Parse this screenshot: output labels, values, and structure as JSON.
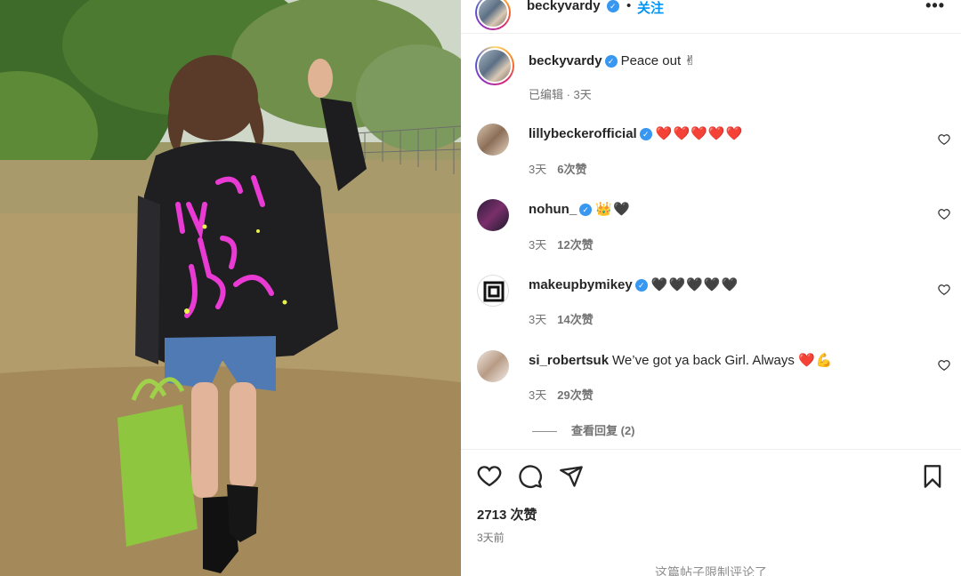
{
  "header": {
    "username": "beckyvardy",
    "follow_label": "关注",
    "more_icon": "more-horizontal-icon"
  },
  "caption": {
    "username": "beckyvardy",
    "text": "Peace out ✌",
    "edited": "已编辑 · 3天"
  },
  "comments": [
    {
      "username": "lillybeckerofficial",
      "text": "",
      "emoji": "❤️❤️❤️❤️❤️",
      "emoji_color": "#e0162b",
      "time": "3天",
      "likes": "6次赞"
    },
    {
      "username": "nohun_",
      "text": "",
      "emoji": "👑🖤",
      "emoji_color": "#262626",
      "time": "3天",
      "likes": "12次赞"
    },
    {
      "username": "makeupbymikey",
      "text": "",
      "emoji": "🖤🖤🖤🖤🖤",
      "emoji_color": "#262626",
      "time": "3天",
      "likes": "14次赞"
    },
    {
      "username": "si_robertsuk",
      "text": "We’ve got ya back Girl. Always",
      "emoji": "❤️💪",
      "emoji_color": "#e0162b",
      "time": "3天",
      "likes": "29次赞"
    }
  ],
  "view_replies": "查看回复 (2)",
  "likes_count": "2713 次赞",
  "post_time": "3天前",
  "comments_limited": "这篇帖子限制评论了",
  "colors": {
    "link": "#0095f6",
    "verified": "#3897f0",
    "text": "#262626",
    "muted": "#737373"
  }
}
